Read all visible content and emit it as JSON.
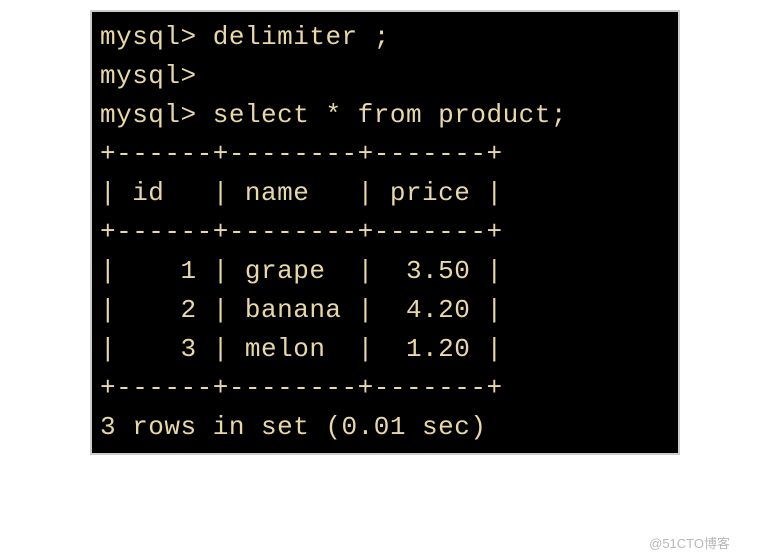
{
  "terminal": {
    "prompt": "mysql>",
    "lines": {
      "line1_cmd": "delimiter ;",
      "line2_cmd": "",
      "line3_cmd": "select * from product;"
    },
    "table": {
      "border_top": "+------+--------+-------+",
      "header_row": "| id   | name   | price |",
      "border_mid": "+------+--------+-------+",
      "row1": "|    1 | grape  |  3.50 |",
      "row2": "|    2 | banana |  4.20 |",
      "row3": "|    3 | melon  |  1.20 |",
      "border_bottom": "+------+--------+-------+"
    },
    "result_status": "3 rows in set (0.01 sec)"
  },
  "watermark": "@51CTO博客",
  "chart_data": {
    "type": "table",
    "columns": [
      "id",
      "name",
      "price"
    ],
    "rows": [
      {
        "id": 1,
        "name": "grape",
        "price": 3.5
      },
      {
        "id": 2,
        "name": "banana",
        "price": 4.2
      },
      {
        "id": 3,
        "name": "melon",
        "price": 1.2
      }
    ],
    "query": "select * from product;",
    "row_count": 3,
    "elapsed_sec": 0.01
  }
}
